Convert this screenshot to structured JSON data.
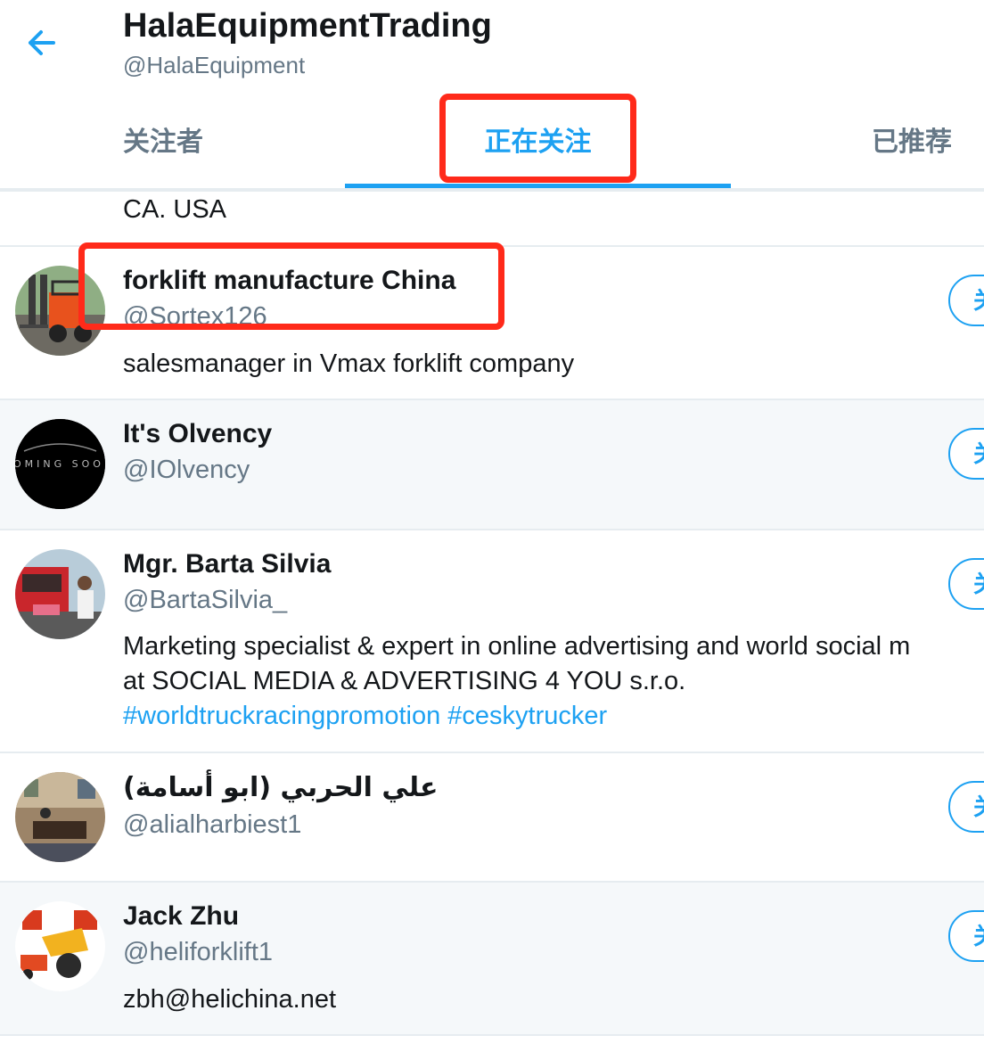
{
  "header": {
    "back_icon": "arrow-left-icon",
    "title": "HalaEquipmentTrading",
    "handle": "@HalaEquipment"
  },
  "tabs": [
    {
      "label": "关注者",
      "active": false
    },
    {
      "label": "正在关注",
      "active": true
    },
    {
      "label": "已推荐",
      "active": false
    }
  ],
  "previous_bio_tail": "CA. USA",
  "users": [
    {
      "name": "forklift manufacture China",
      "handle": "@Sortex126",
      "bio": "salesmanager in Vmax forklift company",
      "button": "关注"
    },
    {
      "name": "It's Olvency",
      "handle": "@IOlvency",
      "avatar_text": "OMING SOO",
      "button": "关注"
    },
    {
      "name": "Mgr. Barta Silvia",
      "handle": "@BartaSilvia_",
      "bio_line1": "Marketing specialist & expert in online advertising and world social m",
      "bio_line2": "at SOCIAL MEDIA & ADVERTISING 4 YOU s.r.o.",
      "hashtag1": "#worldtruckracingpromotion",
      "hashtag2": "#ceskytrucker",
      "button": "关注"
    },
    {
      "name": "علي الحربي (ابو أسامة)",
      "handle": "@alialharbiest1",
      "button": "关注"
    },
    {
      "name": "Jack Zhu",
      "handle": "@heliforklift1",
      "bio": "zbh@helichina.net",
      "button": "关注"
    }
  ],
  "colors": {
    "accent": "#1da1f2",
    "annotation": "#ff2a1a",
    "text_secondary": "#657786",
    "hover_bg": "#f5f8fa"
  }
}
